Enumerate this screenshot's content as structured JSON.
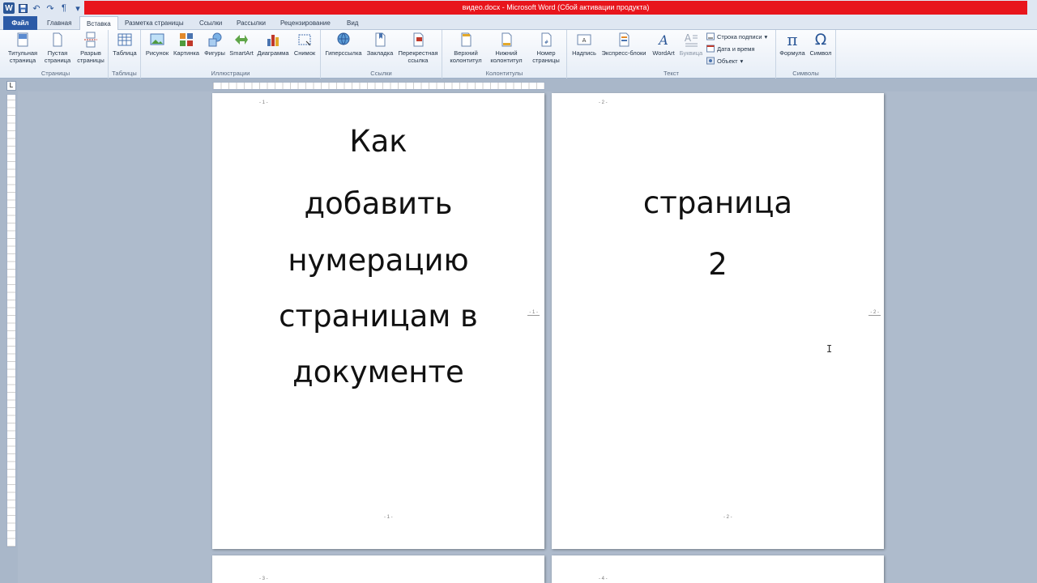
{
  "titlebar": {
    "title": "видео.docx - Microsoft Word (Сбой активации продукта)"
  },
  "tabs": [
    {
      "label": "Файл"
    },
    {
      "label": "Главная"
    },
    {
      "label": "Вставка"
    },
    {
      "label": "Разметка страницы"
    },
    {
      "label": "Ссылки"
    },
    {
      "label": "Рассылки"
    },
    {
      "label": "Рецензирование"
    },
    {
      "label": "Вид"
    }
  ],
  "ribbon": {
    "groups": {
      "pages": "Страницы",
      "tables": "Таблицы",
      "illustrations": "Иллюстрации",
      "links": "Ссылки",
      "headers": "Колонтитулы",
      "text": "Текст",
      "symbols": "Символы"
    },
    "buttons": {
      "cover": "Титульная страница",
      "blank": "Пустая страница",
      "break": "Разрыв страницы",
      "table": "Таблица",
      "picture": "Рисунок",
      "clipart": "Картинка",
      "shapes": "Фигуры",
      "smartart": "SmartArt",
      "chart": "Диаграмма",
      "screenshot": "Снимок",
      "hyperlink": "Гиперссылка",
      "bookmark": "Закладка",
      "crossref": "Перекрестная ссылка",
      "header": "Верхний колонтитул",
      "footer": "Нижний колонтитул",
      "pagenum": "Номер страницы",
      "textbox": "Надпись",
      "quickparts": "Экспресс-блоки",
      "wordart": "WordArt",
      "dropcap": "Буквица",
      "signature": "Строка подписи",
      "datetime": "Дата и время",
      "object": "Объект",
      "equation": "Формула",
      "symbol": "Символ"
    }
  },
  "pages": [
    {
      "header_num": "- 1 -",
      "margin_num": "- 1 -",
      "footer_num": "- 1 -",
      "lines": [
        "Как",
        "добавить",
        "нумерацию",
        "страницам в",
        "документе"
      ]
    },
    {
      "header_num": "- 2 -",
      "margin_num": "- 2 -",
      "footer_num": "- 2 -",
      "lines": [
        "страница",
        "2"
      ]
    },
    {
      "header_num": "- 3 -"
    },
    {
      "header_num": "- 4 -"
    }
  ],
  "colors": {
    "title_bar_error": "#e8151c",
    "file_tab": "#2b5aa6",
    "workspace": "#aebbcc"
  }
}
